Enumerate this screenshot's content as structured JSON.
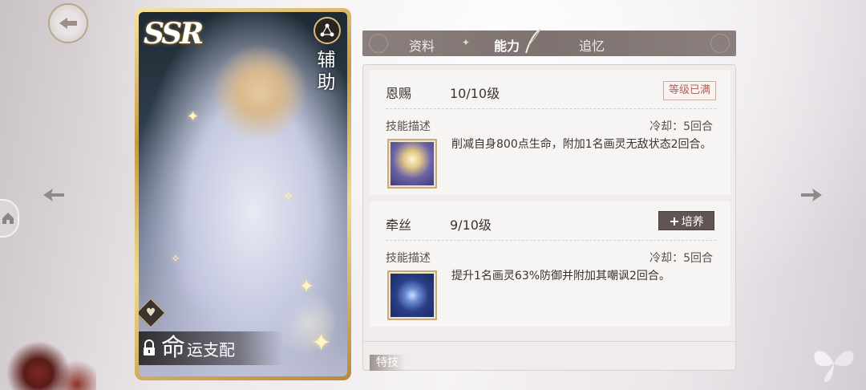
{
  "card": {
    "rarity": "SSR",
    "role": "辅助",
    "fate_big": "命",
    "fate_rest": "运支配"
  },
  "tabs": [
    {
      "label": "资料"
    },
    {
      "label": "能力"
    },
    {
      "label": "追忆"
    }
  ],
  "active_tab": "能力",
  "skills": [
    {
      "name": "恩赐",
      "level": "10/10级",
      "status_badge": "等级已满",
      "desc_label": "技能描述",
      "cooldown": "冷却：5回合",
      "description": "削减自身800点生命，附加1名画灵无敌状态2回合。",
      "icon": "saint-portrait-icon"
    },
    {
      "name": "牵丝",
      "level": "9/10级",
      "button_label": "培养",
      "desc_label": "技能描述",
      "cooldown": "冷却：5回合",
      "description": "提升1名画灵63%防御并附加其嘲讽2回合。",
      "icon": "compass-rune-icon"
    }
  ],
  "trait_label": "特技",
  "icons": {
    "back": "back-arrow-icon",
    "prev": "prev-arrow-icon",
    "next": "next-arrow-icon",
    "heart": "heart-icon",
    "lock": "lock-icon",
    "role": "support-role-icon",
    "home": "home-icon"
  }
}
